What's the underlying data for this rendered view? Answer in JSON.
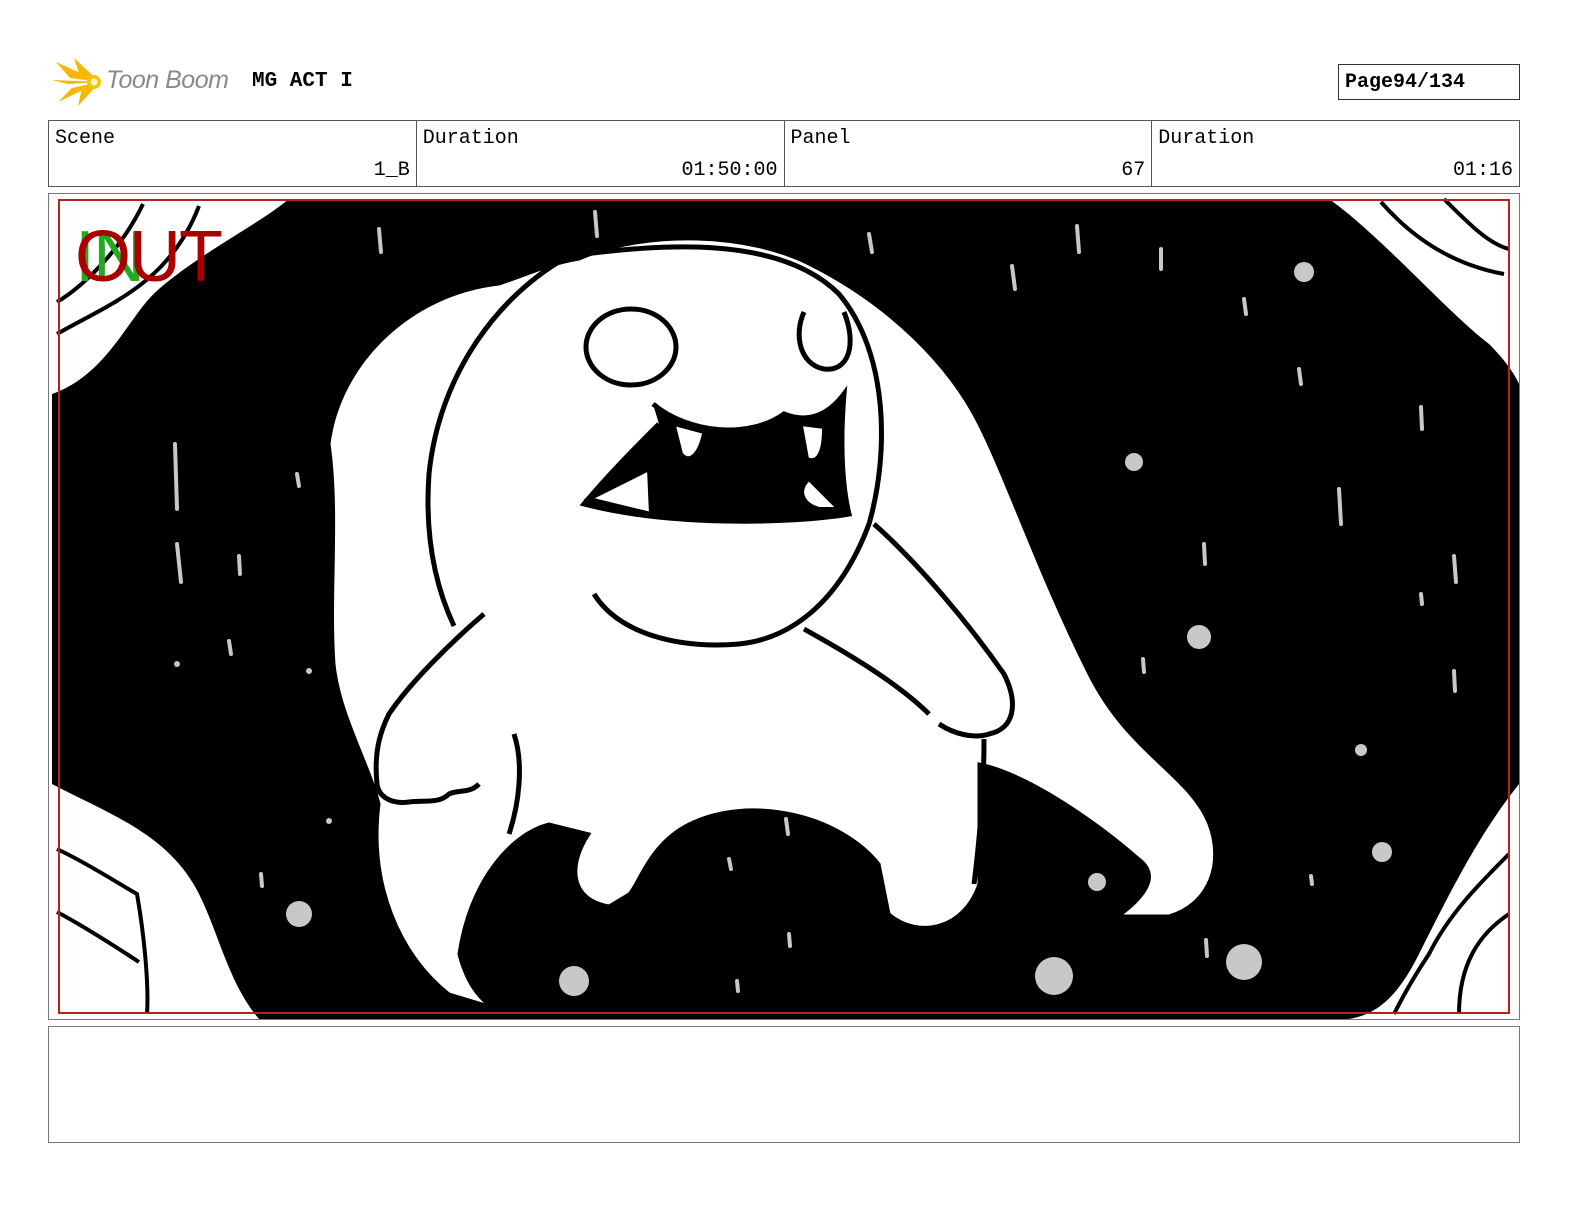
{
  "header": {
    "logo_text": "Toon Boom",
    "project_title": "MG ACT I",
    "page_label": "Page",
    "page_number": "94/134"
  },
  "info": {
    "scene_label": "Scene",
    "scene_value": "1_B",
    "scene_duration_label": "Duration",
    "scene_duration_value": "01:50:00",
    "panel_label": "Panel",
    "panel_value": "67",
    "panel_duration_label": "Duration",
    "panel_duration_value": "01:16"
  },
  "panel": {
    "in_marker": "IN",
    "out_marker": "OUT",
    "colors": {
      "in_marker": "#22aa22",
      "out_marker": "#aa0000",
      "safe_frame": "#b22222",
      "snow": "#c8c8c8"
    }
  },
  "notes": {
    "text": ""
  }
}
